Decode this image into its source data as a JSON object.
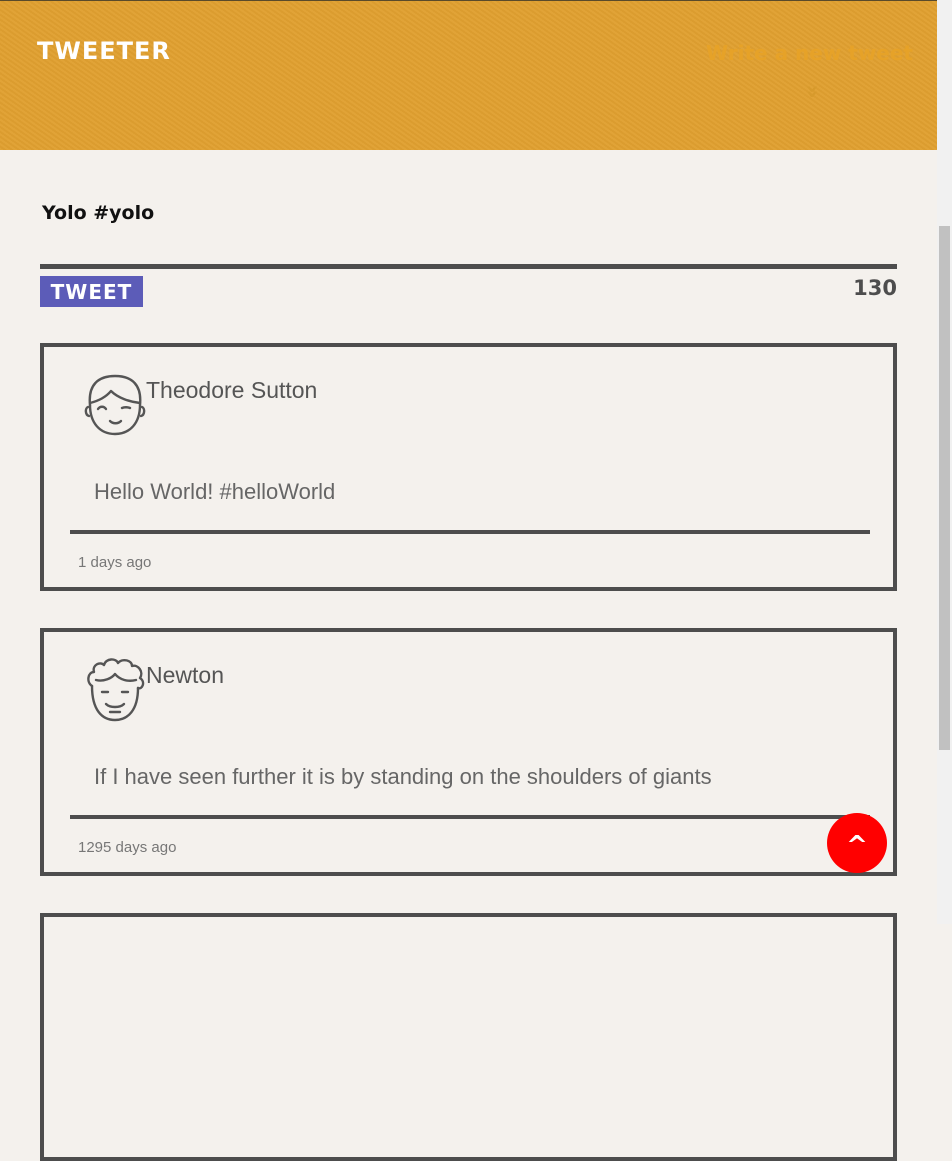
{
  "header": {
    "brand": "TWEETER",
    "write_new": "Write a new tweet",
    "toggle_icon": "double-chevron-down-icon",
    "toggle_glyph": "»"
  },
  "composer": {
    "text": "Yolo #yolo",
    "tweet_label": "TWEET",
    "counter": "130"
  },
  "tweets": [
    {
      "author": "Theodore Sutton",
      "avatar_icon": "winking-boy-face-icon",
      "text": "Hello World! #helloWorld",
      "time": "1 days ago"
    },
    {
      "author": "Newton",
      "avatar_icon": "curly-hair-face-icon",
      "text": "If I have seen further it is by standing on the shoulders of giants",
      "time": "1295 days ago"
    }
  ],
  "scroll_top": {
    "label": "^"
  },
  "colors": {
    "header_bg": "#e0a030",
    "accent": "#5c5cb8",
    "page_bg": "#f4f1ed",
    "border": "#4d4d4d",
    "scroll_top_bg": "#ff0000"
  }
}
